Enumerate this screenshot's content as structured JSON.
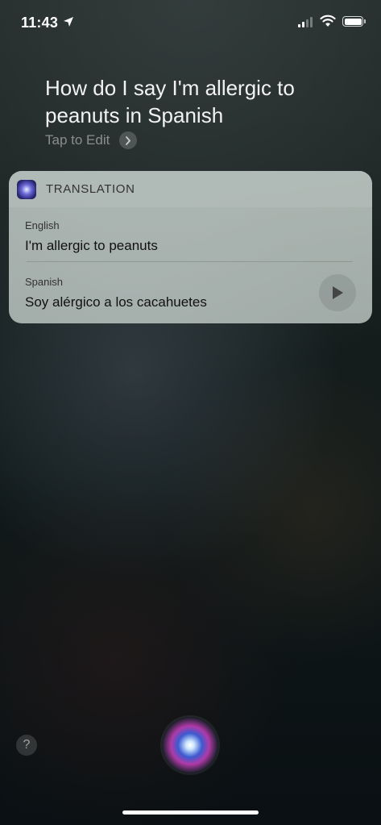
{
  "status_bar": {
    "time": "11:43",
    "location_icon": "location-arrow-icon",
    "signal_icon": "cellular-signal-icon",
    "wifi_icon": "wifi-icon",
    "battery_icon": "battery-icon"
  },
  "siri": {
    "query": "How do I say I'm allergic to peanuts in Spanish",
    "tap_to_edit": "Tap to Edit"
  },
  "card": {
    "title": "TRANSLATION",
    "source_language": "English",
    "source_text": "I'm allergic to peanuts",
    "target_language": "Spanish",
    "target_text": "Soy alérgico a los cacahuetes"
  },
  "bottom": {
    "help_label": "?"
  }
}
